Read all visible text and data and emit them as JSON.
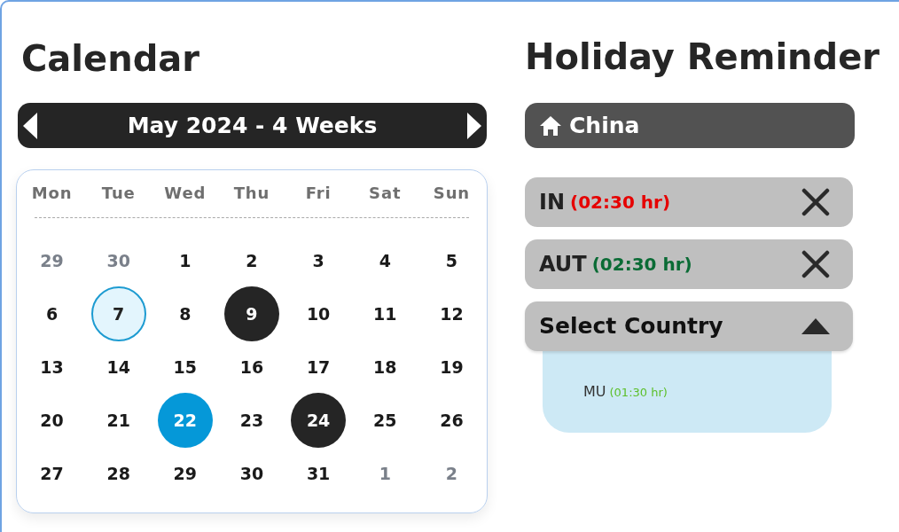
{
  "calendar": {
    "title": "Calendar",
    "period": "May 2024 - 4 Weeks",
    "weekdays": [
      "Mon",
      "Tue",
      "Wed",
      "Thu",
      "Fri",
      "Sat",
      "Sun"
    ],
    "days": [
      {
        "label": "29",
        "kind": "other"
      },
      {
        "label": "30",
        "kind": "other"
      },
      {
        "label": "1",
        "kind": "normal"
      },
      {
        "label": "2",
        "kind": "normal"
      },
      {
        "label": "3",
        "kind": "normal"
      },
      {
        "label": "4",
        "kind": "normal"
      },
      {
        "label": "5",
        "kind": "normal"
      },
      {
        "label": "6",
        "kind": "normal"
      },
      {
        "label": "7",
        "kind": "today"
      },
      {
        "label": "8",
        "kind": "normal"
      },
      {
        "label": "9",
        "kind": "marked"
      },
      {
        "label": "10",
        "kind": "normal"
      },
      {
        "label": "11",
        "kind": "normal"
      },
      {
        "label": "12",
        "kind": "normal"
      },
      {
        "label": "13",
        "kind": "normal"
      },
      {
        "label": "14",
        "kind": "normal"
      },
      {
        "label": "15",
        "kind": "normal"
      },
      {
        "label": "16",
        "kind": "normal"
      },
      {
        "label": "17",
        "kind": "normal"
      },
      {
        "label": "18",
        "kind": "normal"
      },
      {
        "label": "19",
        "kind": "normal"
      },
      {
        "label": "20",
        "kind": "normal"
      },
      {
        "label": "21",
        "kind": "normal"
      },
      {
        "label": "22",
        "kind": "selected"
      },
      {
        "label": "23",
        "kind": "normal"
      },
      {
        "label": "24",
        "kind": "marked"
      },
      {
        "label": "25",
        "kind": "normal"
      },
      {
        "label": "26",
        "kind": "normal"
      },
      {
        "label": "27",
        "kind": "normal"
      },
      {
        "label": "28",
        "kind": "normal"
      },
      {
        "label": "29",
        "kind": "normal"
      },
      {
        "label": "30",
        "kind": "normal"
      },
      {
        "label": "31",
        "kind": "normal"
      },
      {
        "label": "1",
        "kind": "other"
      },
      {
        "label": "2",
        "kind": "other"
      }
    ]
  },
  "reminder": {
    "title": "Holiday Reminder",
    "home": "China",
    "countries": [
      {
        "code": "IN",
        "offset": "(02:30 hr)",
        "color": "#e60000"
      },
      {
        "code": "AUT",
        "offset": "(02:30 hr)",
        "color": "#0a6b35"
      }
    ],
    "select": {
      "label": "Select Country",
      "expanded": true,
      "options": [
        {
          "code": "MU",
          "offset": "(01:30 hr)",
          "color": "#5cbf2a"
        }
      ]
    }
  }
}
